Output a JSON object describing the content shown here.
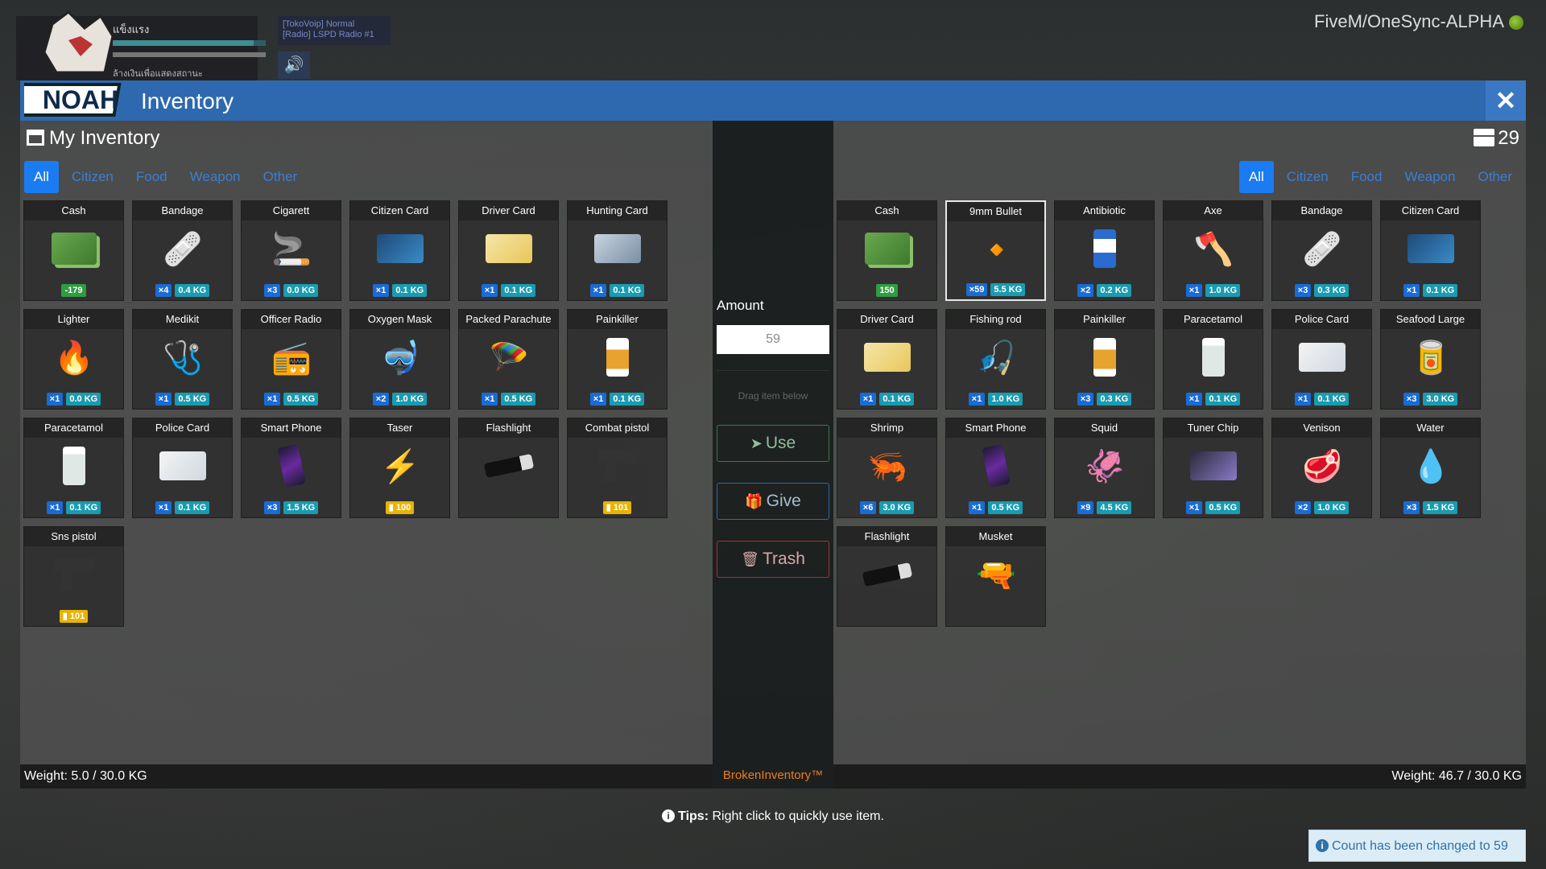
{
  "hud": {
    "player_name": "แข็งแรง",
    "sub_text": "ล้างเงินเพื่อแสดงสถานะ",
    "voip_line1": "[TokoVoip] Normal",
    "voip_line2": "[Radio] LSPD Radio #1",
    "server": "FiveM/OneSync-ALPHA",
    "logo_text": "NOAH"
  },
  "window": {
    "title": "Inventory",
    "close_glyph": "✕"
  },
  "left": {
    "title": "My Inventory",
    "tabs": [
      "All",
      "Citizen",
      "Food",
      "Weapon",
      "Other"
    ],
    "weight": "Weight: 5.0 / 30.0 KG",
    "items": [
      {
        "name": "Cash",
        "icon": "cash-icon",
        "money": "-179"
      },
      {
        "name": "Bandage",
        "icon": "bandage-icon",
        "qty": "×4",
        "kg": "0.4 KG"
      },
      {
        "name": "Cigarett",
        "icon": "cigarette-icon",
        "qty": "×3",
        "kg": "0.0 KG"
      },
      {
        "name": "Citizen Card",
        "icon": "citizen-card-icon",
        "qty": "×1",
        "kg": "0.1 KG"
      },
      {
        "name": "Driver Card",
        "icon": "driver-card-icon",
        "qty": "×1",
        "kg": "0.1 KG"
      },
      {
        "name": "Hunting Card",
        "icon": "hunting-card-icon",
        "qty": "×1",
        "kg": "0.1 KG"
      },
      {
        "name": "Lighter",
        "icon": "lighter-icon",
        "qty": "×1",
        "kg": "0.0 KG"
      },
      {
        "name": "Medikit",
        "icon": "medikit-icon",
        "qty": "×1",
        "kg": "0.5 KG"
      },
      {
        "name": "Officer Radio",
        "icon": "radio-icon",
        "qty": "×1",
        "kg": "0.5 KG"
      },
      {
        "name": "Oxygen Mask",
        "icon": "oxygen-mask-icon",
        "qty": "×2",
        "kg": "1.0 KG"
      },
      {
        "name": "Packed Parachute",
        "icon": "parachute-icon",
        "qty": "×1",
        "kg": "0.5 KG"
      },
      {
        "name": "Painkiller",
        "icon": "pill-bottle-icon",
        "qty": "×1",
        "kg": "0.1 KG"
      },
      {
        "name": "Paracetamol",
        "icon": "medicine-bottle-icon",
        "qty": "×1",
        "kg": "0.1 KG"
      },
      {
        "name": "Police Card",
        "icon": "police-card-icon",
        "qty": "×1",
        "kg": "0.1 KG"
      },
      {
        "name": "Smart Phone",
        "icon": "phone-icon",
        "qty": "×3",
        "kg": "1.5 KG"
      },
      {
        "name": "Taser",
        "icon": "taser-icon",
        "ammo": "100"
      },
      {
        "name": "Flashlight",
        "icon": "flashlight-icon"
      },
      {
        "name": "Combat pistol",
        "icon": "pistol-icon",
        "ammo": "101"
      },
      {
        "name": "Sns pistol",
        "icon": "sns-pistol-icon",
        "ammo": "101"
      }
    ]
  },
  "middle": {
    "amount_label": "Amount",
    "amount_value": "59",
    "drag_hint": "Drag item below",
    "use_label": "Use",
    "give_label": "Give",
    "trash_label": "Trash",
    "brand": "BrokenInventory™"
  },
  "right": {
    "count": "29",
    "tabs": [
      "All",
      "Citizen",
      "Food",
      "Weapon",
      "Other"
    ],
    "weight": "Weight: 46.7 / 30.0 KG",
    "items": [
      {
        "name": "Cash",
        "icon": "cash-icon",
        "money": "150"
      },
      {
        "name": "9mm Bullet",
        "icon": "bullet-icon",
        "qty": "×59",
        "kg": "5.5 KG",
        "selected": true
      },
      {
        "name": "Antibiotic",
        "icon": "antibiotic-bottle-icon",
        "qty": "×2",
        "kg": "0.2 KG"
      },
      {
        "name": "Axe",
        "icon": "axe-icon",
        "qty": "×1",
        "kg": "1.0 KG"
      },
      {
        "name": "Bandage",
        "icon": "bandage-icon",
        "qty": "×3",
        "kg": "0.3 KG"
      },
      {
        "name": "Citizen Card",
        "icon": "citizen-card-icon",
        "qty": "×1",
        "kg": "0.1 KG"
      },
      {
        "name": "Driver Card",
        "icon": "driver-card-icon",
        "qty": "×1",
        "kg": "0.1 KG"
      },
      {
        "name": "Fishing rod",
        "icon": "fishing-rod-icon",
        "qty": "×1",
        "kg": "1.0 KG"
      },
      {
        "name": "Painkiller",
        "icon": "pill-bottle-icon",
        "qty": "×3",
        "kg": "0.3 KG"
      },
      {
        "name": "Paracetamol",
        "icon": "medicine-bottle-icon",
        "qty": "×1",
        "kg": "0.1 KG"
      },
      {
        "name": "Police Card",
        "icon": "police-card-icon",
        "qty": "×1",
        "kg": "0.1 KG"
      },
      {
        "name": "Seafood Large",
        "icon": "seafood-icon",
        "qty": "×3",
        "kg": "3.0 KG"
      },
      {
        "name": "Shrimp",
        "icon": "shrimp-icon",
        "qty": "×6",
        "kg": "3.0 KG"
      },
      {
        "name": "Smart Phone",
        "icon": "phone-icon",
        "qty": "×1",
        "kg": "0.5 KG"
      },
      {
        "name": "Squid",
        "icon": "squid-icon",
        "qty": "×9",
        "kg": "4.5 KG"
      },
      {
        "name": "Tuner Chip",
        "icon": "tablet-icon",
        "qty": "×1",
        "kg": "0.5 KG"
      },
      {
        "name": "Venison",
        "icon": "meat-icon",
        "qty": "×2",
        "kg": "1.0 KG"
      },
      {
        "name": "Water",
        "icon": "water-bottle-icon",
        "qty": "×3",
        "kg": "1.5 KG"
      },
      {
        "name": "Flashlight",
        "icon": "flashlight-icon"
      },
      {
        "name": "Musket",
        "icon": "musket-icon"
      }
    ]
  },
  "footer": {
    "tips_label": "Tips:",
    "tips_text": " Right click to quickly use item.",
    "toast": "Count has been changed to 59"
  }
}
